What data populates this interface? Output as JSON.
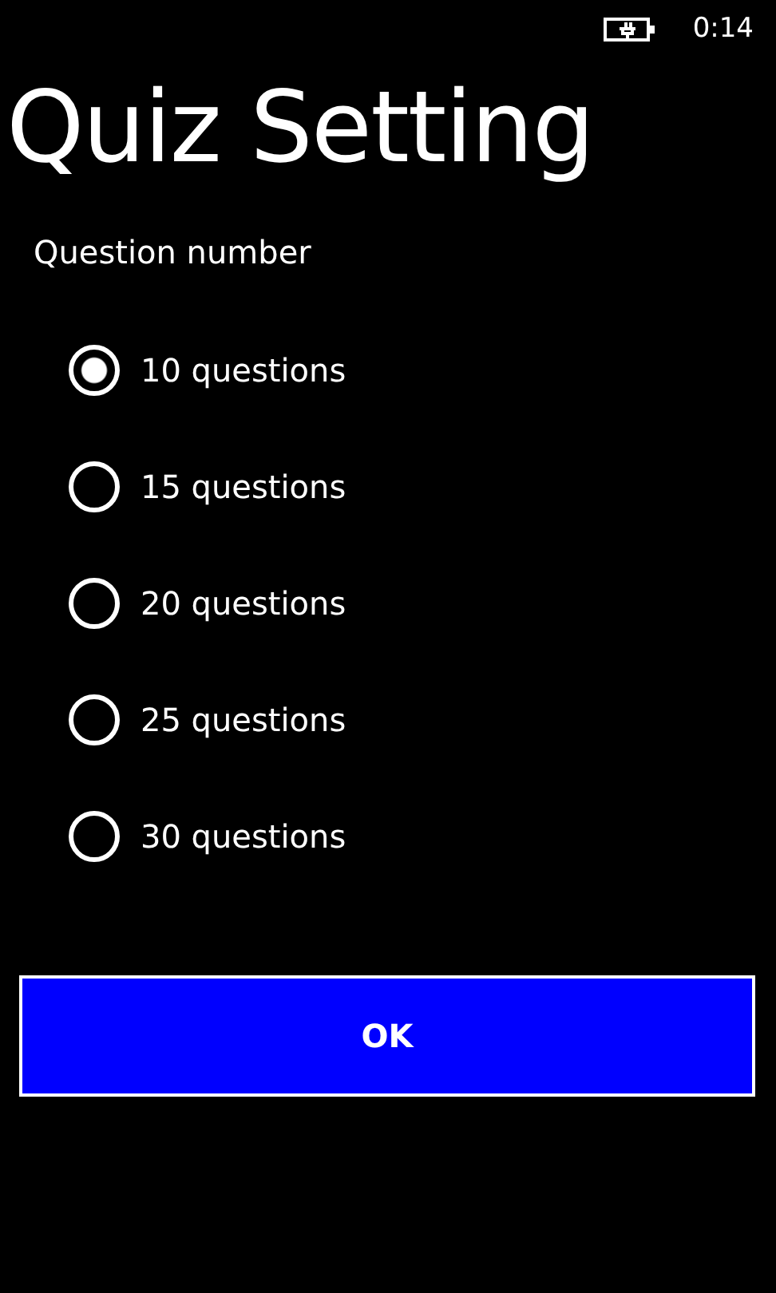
{
  "status_bar": {
    "time": "0:14"
  },
  "title": "Quiz Setting",
  "group_label": "Question number",
  "options": [
    {
      "label": "10 questions",
      "selected": true
    },
    {
      "label": "15 questions",
      "selected": false
    },
    {
      "label": "20 questions",
      "selected": false
    },
    {
      "label": "25 questions",
      "selected": false
    },
    {
      "label": "30 questions",
      "selected": false
    }
  ],
  "button": "OK"
}
